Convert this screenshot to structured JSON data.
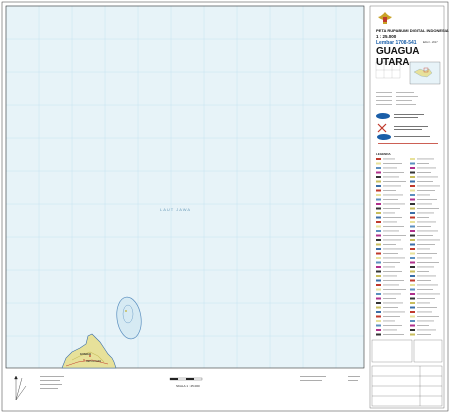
{
  "map": {
    "title_line": "PETA RUPABUMI DIGITAL INDONESIA",
    "scale_text": "1 : 25.000",
    "sheet_number": "Lembar 1708-541",
    "edition": "Edisi I - 2017",
    "sheet_name": "GUAGUA UTARA",
    "sea_label": "LAUT JAWA",
    "legend_heading": "LEGENDA",
    "scale_bar_label": "SKALA 1 : 25.000",
    "place_labels": [
      "GUAGUA",
      "KEPULAUAN"
    ]
  },
  "colors": {
    "sea": "#e7f3f8",
    "grid": "#bfe0ef",
    "coast": "#3a6ea8",
    "land": "#e7e19a",
    "land_dark": "#c8bd5c",
    "reef": "#5b8fbf",
    "frame": "#333333",
    "red": "#c0392b",
    "magenta": "#b0308c"
  },
  "icons": {
    "emblem": "garuda-emblem-icon",
    "agency_logo": "agency-logo-icon",
    "north": "north-arrow-icon"
  }
}
